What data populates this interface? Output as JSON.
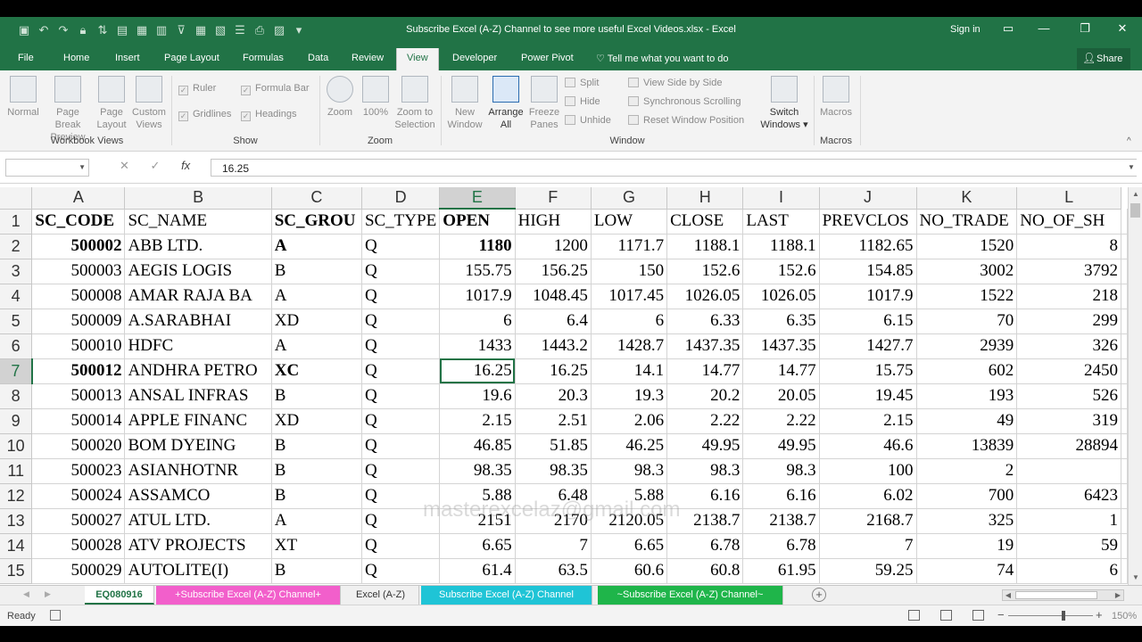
{
  "window": {
    "title": "Subscribe Excel (A-Z) Channel to see more useful Excel Videos.xlsx - Excel",
    "sign_in": "Sign in",
    "share": "Share"
  },
  "qat_icons": [
    "save-icon",
    "undo-icon",
    "redo-icon",
    "lock-icon",
    "sort-icon"
  ],
  "tabs": [
    "File",
    "Home",
    "Insert",
    "Page Layout",
    "Formulas",
    "Data",
    "Review",
    "View",
    "Developer",
    "Power Pivot"
  ],
  "active_tab": "View",
  "tell_me": "Tell me what you want to do",
  "ribbon": {
    "workbook_views": {
      "label": "Workbook Views",
      "normal": "Normal",
      "page_break_1": "Page Break",
      "page_break_2": "Preview",
      "page_layout_1": "Page",
      "page_layout_2": "Layout",
      "custom_1": "Custom",
      "custom_2": "Views"
    },
    "show": {
      "label": "Show",
      "ruler": "Ruler",
      "formula_bar": "Formula Bar",
      "gridlines": "Gridlines",
      "headings": "Headings"
    },
    "zoom": {
      "label": "Zoom",
      "zoom": "Zoom",
      "hundred": "100%",
      "zoom_sel_1": "Zoom to",
      "zoom_sel_2": "Selection"
    },
    "window": {
      "label": "Window",
      "new_1": "New",
      "new_2": "Window",
      "arrange_1": "Arrange",
      "arrange_2": "All",
      "freeze_1": "Freeze",
      "freeze_2": "Panes",
      "split": "Split",
      "hide": "Hide",
      "unhide": "Unhide",
      "side_by_side": "View Side by Side",
      "sync_scroll": "Synchronous Scrolling",
      "reset_pos": "Reset Window Position",
      "switch_1": "Switch",
      "switch_2": "Windows"
    },
    "macros": {
      "label": "Macros",
      "macros": "Macros"
    }
  },
  "formula_bar": {
    "name_box": "",
    "cancel": "✕",
    "enter": "✓",
    "fx": "fx",
    "content": "16.25"
  },
  "columns": [
    "A",
    "B",
    "C",
    "D",
    "E",
    "F",
    "G",
    "H",
    "I",
    "J",
    "K",
    "L"
  ],
  "rows": [
    {
      "n": "1",
      "cells": [
        "SC_CODE",
        "SC_NAME",
        "SC_GROU",
        "SC_TYPE",
        "OPEN",
        "HIGH",
        "LOW",
        "CLOSE",
        "LAST",
        "PREVCLOS",
        "NO_TRADE",
        "NO_OF_SH"
      ]
    },
    {
      "n": "2",
      "cells": [
        "500002",
        "ABB LTD.",
        "A",
        "Q",
        "1180",
        "1200",
        "1171.7",
        "1188.1",
        "1188.1",
        "1182.65",
        "1520",
        "8"
      ]
    },
    {
      "n": "3",
      "cells": [
        "500003",
        "AEGIS LOGIS",
        "B",
        "Q",
        "155.75",
        "156.25",
        "150",
        "152.6",
        "152.6",
        "154.85",
        "3002",
        "3792"
      ]
    },
    {
      "n": "4",
      "cells": [
        "500008",
        "AMAR RAJA BA",
        "A",
        "Q",
        "1017.9",
        "1048.45",
        "1017.45",
        "1026.05",
        "1026.05",
        "1017.9",
        "1522",
        "218"
      ]
    },
    {
      "n": "5",
      "cells": [
        "500009",
        "A.SARABHAI",
        "XD",
        "Q",
        "6",
        "6.4",
        "6",
        "6.33",
        "6.35",
        "6.15",
        "70",
        "299"
      ]
    },
    {
      "n": "6",
      "cells": [
        "500010",
        "HDFC",
        "A",
        "Q",
        "1433",
        "1443.2",
        "1428.7",
        "1437.35",
        "1437.35",
        "1427.7",
        "2939",
        "326"
      ]
    },
    {
      "n": "7",
      "cells": [
        "500012",
        "ANDHRA PETRO",
        "XC",
        "Q",
        "16.25",
        "16.25",
        "14.1",
        "14.77",
        "14.77",
        "15.75",
        "602",
        "2450"
      ]
    },
    {
      "n": "8",
      "cells": [
        "500013",
        "ANSAL INFRAS",
        "B",
        "Q",
        "19.6",
        "20.3",
        "19.3",
        "20.2",
        "20.05",
        "19.45",
        "193",
        "526"
      ]
    },
    {
      "n": "9",
      "cells": [
        "500014",
        "APPLE FINANC",
        "XD",
        "Q",
        "2.15",
        "2.51",
        "2.06",
        "2.22",
        "2.22",
        "2.15",
        "49",
        "319"
      ]
    },
    {
      "n": "10",
      "cells": [
        "500020",
        "BOM DYEING",
        "B",
        "Q",
        "46.85",
        "51.85",
        "46.25",
        "49.95",
        "49.95",
        "46.6",
        "13839",
        "28894"
      ]
    },
    {
      "n": "11",
      "cells": [
        "500023",
        "ASIANHOTNR",
        "B",
        "Q",
        "98.35",
        "98.35",
        "98.3",
        "98.3",
        "98.3",
        "100",
        "2",
        ""
      ]
    },
    {
      "n": "12",
      "cells": [
        "500024",
        "ASSAMCO",
        "B",
        "Q",
        "5.88",
        "6.48",
        "5.88",
        "6.16",
        "6.16",
        "6.02",
        "700",
        "6423"
      ]
    },
    {
      "n": "13",
      "cells": [
        "500027",
        "ATUL LTD.",
        "A",
        "Q",
        "2151",
        "2170",
        "2120.05",
        "2138.7",
        "2138.7",
        "2168.7",
        "325",
        "1"
      ]
    },
    {
      "n": "14",
      "cells": [
        "500028",
        "ATV PROJECTS",
        "XT",
        "Q",
        "6.65",
        "7",
        "6.65",
        "6.78",
        "6.78",
        "7",
        "19",
        "59"
      ]
    },
    {
      "n": "15",
      "cells": [
        "500029",
        "AUTOLITE(I)",
        "B",
        "Q",
        "61.4",
        "63.5",
        "60.6",
        "60.8",
        "61.95",
        "59.25",
        "74",
        "6"
      ]
    }
  ],
  "watermark": "masterexcelaz@gmail.com",
  "sheet_tabs": [
    {
      "label": "EQ080916",
      "bg": "#ffffff",
      "color": "#217346"
    },
    {
      "label": "+Subscribe Excel (A-Z) Channel+",
      "bg": "#f25fcb",
      "color": "#ffffff"
    },
    {
      "label": "Excel (A-Z)",
      "bg": "#f0f0f0",
      "color": "#333333"
    },
    {
      "label": "Subscribe Excel (A-Z) Channel",
      "bg": "#1fc4d6",
      "color": "#ffffff"
    },
    {
      "label": "~Subscribe Excel (A-Z) Channel~",
      "bg": "#1fb54a",
      "color": "#ffffff"
    }
  ],
  "status": {
    "ready": "Ready",
    "zoom": "150%"
  },
  "colors": {
    "excel_green": "#217346",
    "ribbon_bg": "#f3f3f3"
  }
}
